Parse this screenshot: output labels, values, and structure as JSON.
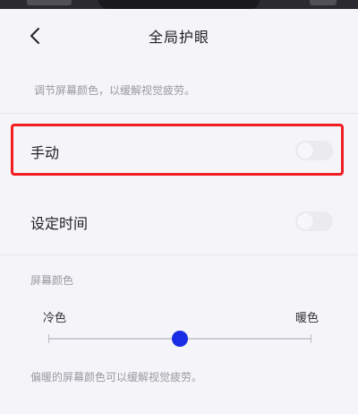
{
  "header": {
    "title": "全局护眼"
  },
  "description": "调节屏幕颜色，以缓解视觉疲劳。",
  "rows": [
    {
      "label": "手动",
      "enabled": false
    },
    {
      "label": "设定时间",
      "enabled": false
    }
  ],
  "screen_color": {
    "section_label": "屏幕颜色",
    "cold_label": "冷色",
    "warm_label": "暖色",
    "value": 0.5,
    "thumb_color": "#1a2de6"
  },
  "footer_note": "偏暖的屏幕颜色可以缓解视觉疲劳。",
  "colors": {
    "highlight": "#f01e23"
  }
}
